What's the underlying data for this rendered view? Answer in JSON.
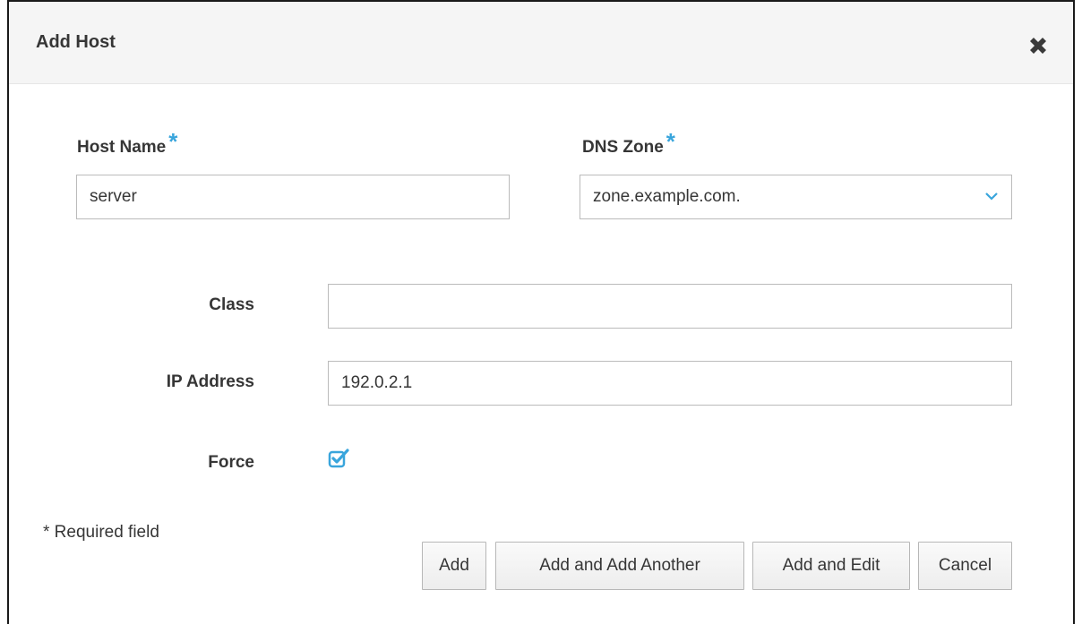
{
  "dialog": {
    "title": "Add Host",
    "close_icon": "close-icon"
  },
  "fields": {
    "host_name": {
      "label": "Host Name",
      "required_marker": "*",
      "value": "server"
    },
    "dns_zone": {
      "label": "DNS Zone",
      "required_marker": "*",
      "selected": "zone.example.com.",
      "icon": "chevron-down-icon"
    },
    "class": {
      "label": "Class",
      "value": ""
    },
    "ip_address": {
      "label": "IP Address",
      "value": "192.0.2.1"
    },
    "force": {
      "label": "Force",
      "checked": true,
      "icon": "checkbox-checked-icon"
    }
  },
  "footer": {
    "required_note": "* Required field",
    "buttons": {
      "add": "Add",
      "add_another": "Add and Add Another",
      "add_edit": "Add and Edit",
      "cancel": "Cancel"
    }
  },
  "colors": {
    "accent": "#39a5dc",
    "header_bg": "#f5f5f5",
    "text": "#363636"
  }
}
